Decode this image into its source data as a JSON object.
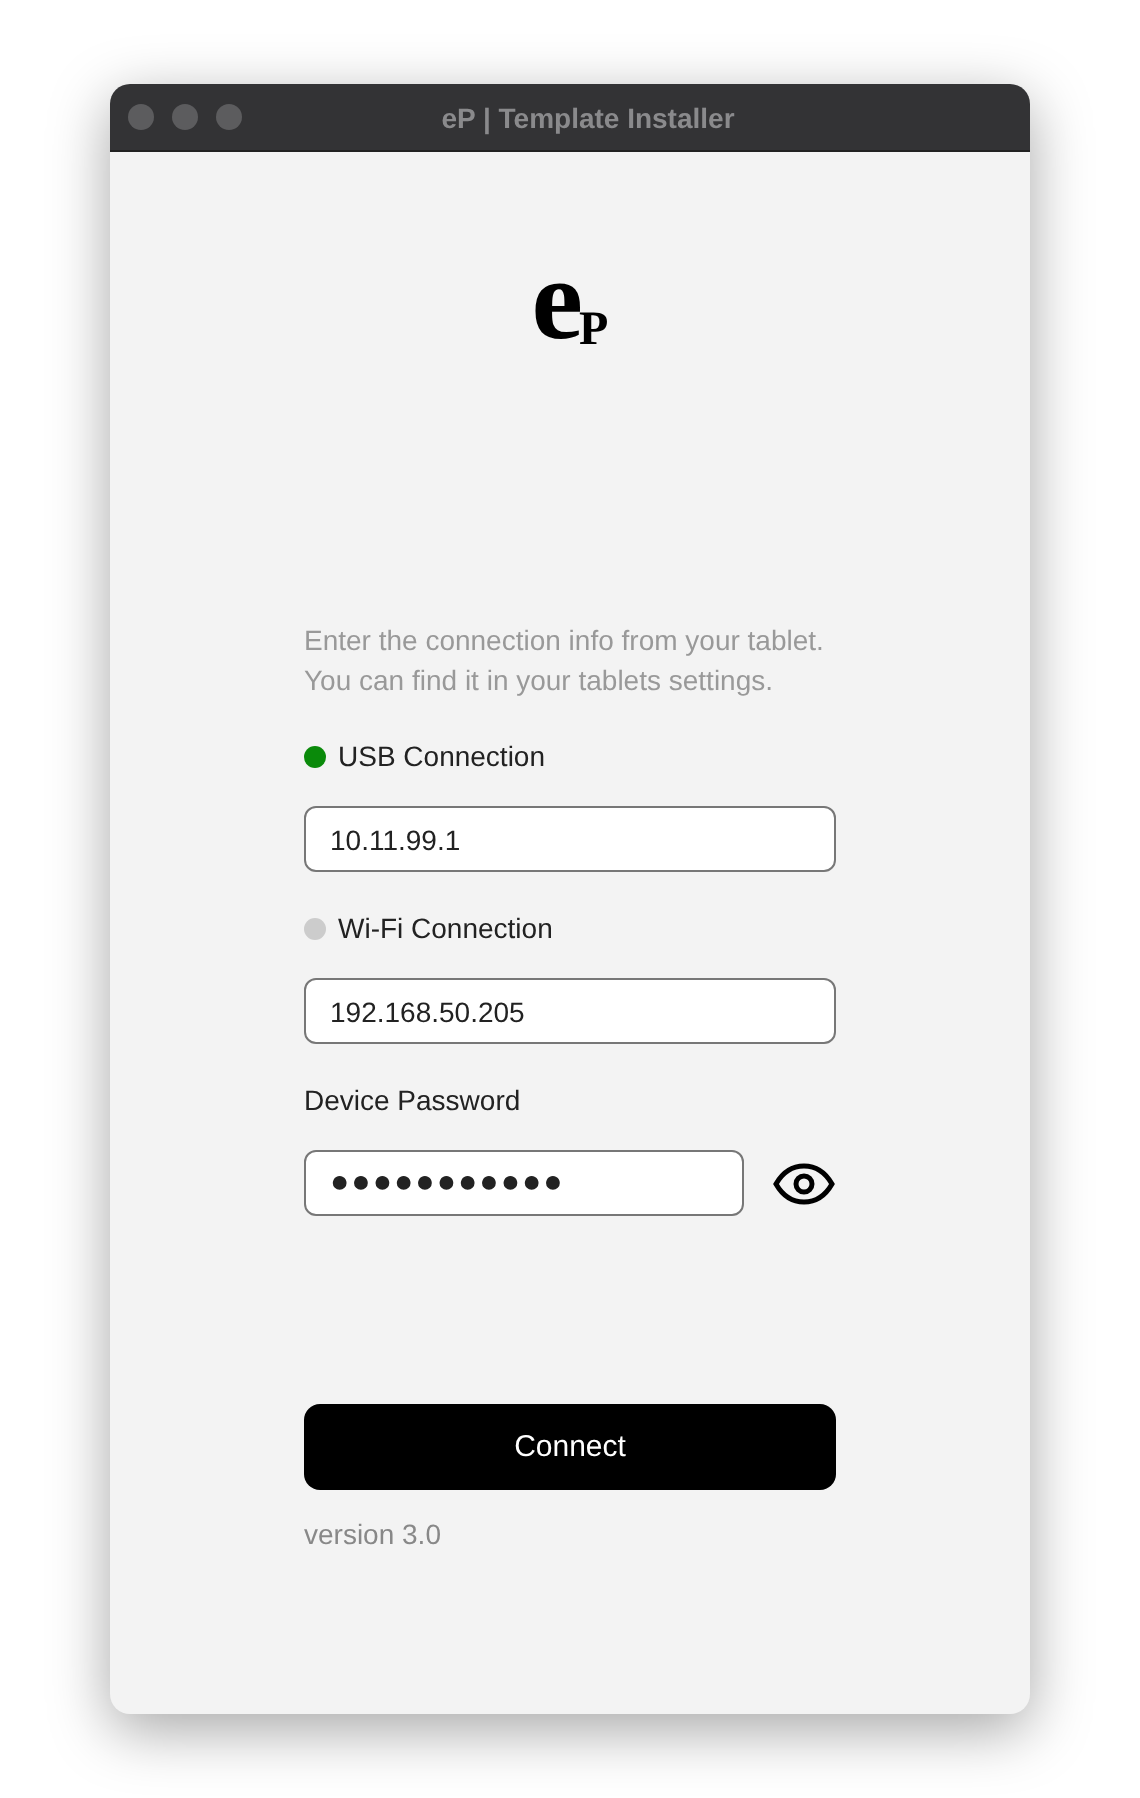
{
  "window": {
    "title": "eP | Template Installer"
  },
  "logo": {
    "main": "e",
    "sub": "P"
  },
  "intro": [
    "Enter the connection info from your tablet.",
    "You can find it in your tablets settings."
  ],
  "connections": [
    {
      "label": "USB Connection",
      "color": "#0a8a0a",
      "value": "10.11.99.1"
    },
    {
      "label": "Wi-Fi Connection",
      "color": "#cccccc",
      "value": "192.168.50.205"
    }
  ],
  "password": {
    "label": "Device Password",
    "value": "●●●●●●●●●●●"
  },
  "connect_button": "Connect",
  "version": "version 3.0"
}
